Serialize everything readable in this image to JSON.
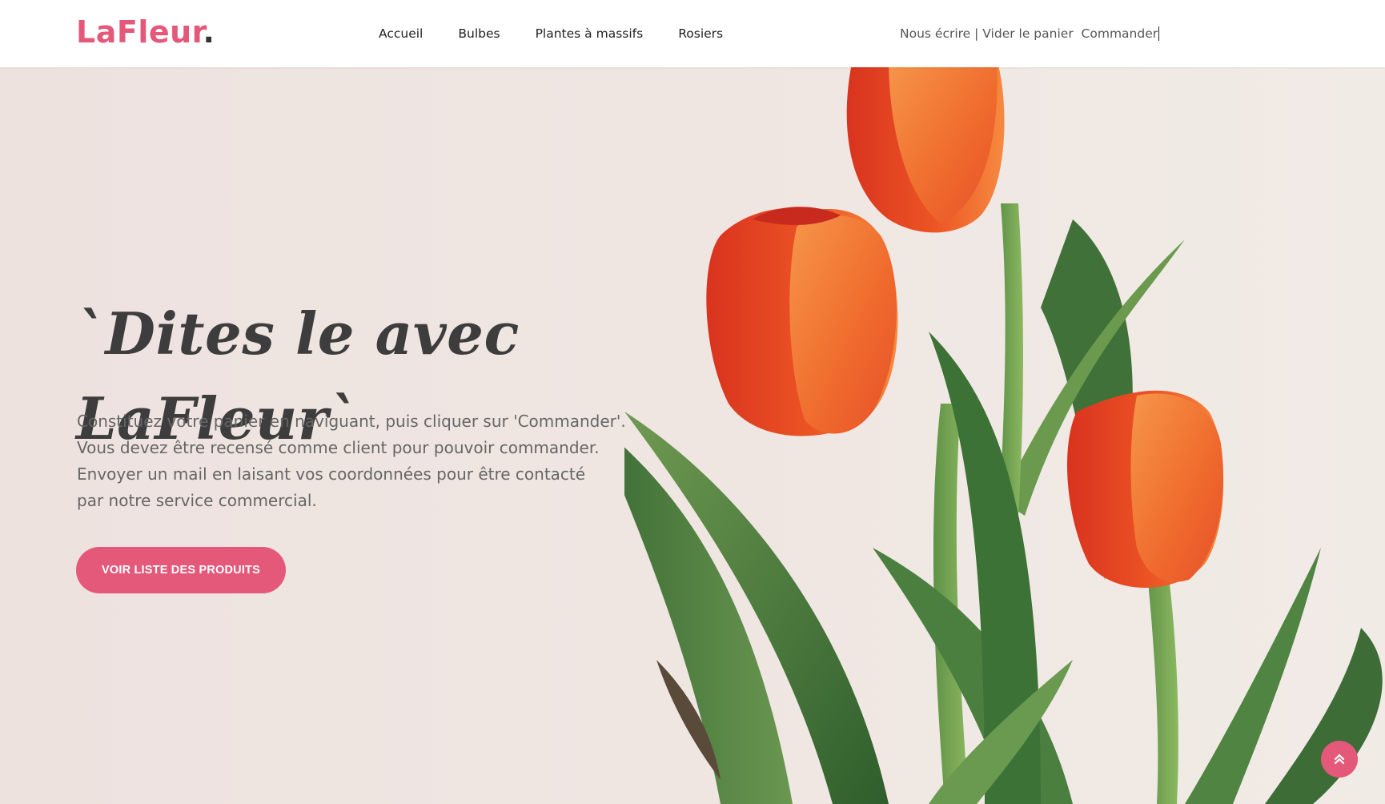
{
  "header": {
    "brand_name": "LaFleur",
    "brand_dot": ".",
    "nav": [
      {
        "label": "Accueil"
      },
      {
        "label": "Bulbes"
      },
      {
        "label": "Plantes à massifs"
      },
      {
        "label": "Rosiers"
      }
    ],
    "utility": {
      "write_label": "Nous écrire",
      "separator": " | ",
      "empty_cart_label": "Vider le panier",
      "order_label": "Commander"
    }
  },
  "hero": {
    "title_line1": "`Dites le avec",
    "title_line2": "LaFleur`",
    "description_lines": [
      "Constituez votre panier en naviguant, puis cliquer sur 'Commander'.",
      "Vous devez être recensé comme client pour pouvoir commander.",
      "Envoyer un mail en laisant vos coordonnées pour être contacté",
      "par notre service commercial."
    ],
    "cta_label": "VOIR LISTE DES PRODUITS",
    "image_subject": "red-orange tulips"
  },
  "scroll_top": {
    "icon": "double-chevron-up-icon"
  },
  "colors": {
    "accent": "#e4587a",
    "heading": "#3d3d3d",
    "body_text": "#666666",
    "background": "#efe5e2"
  }
}
